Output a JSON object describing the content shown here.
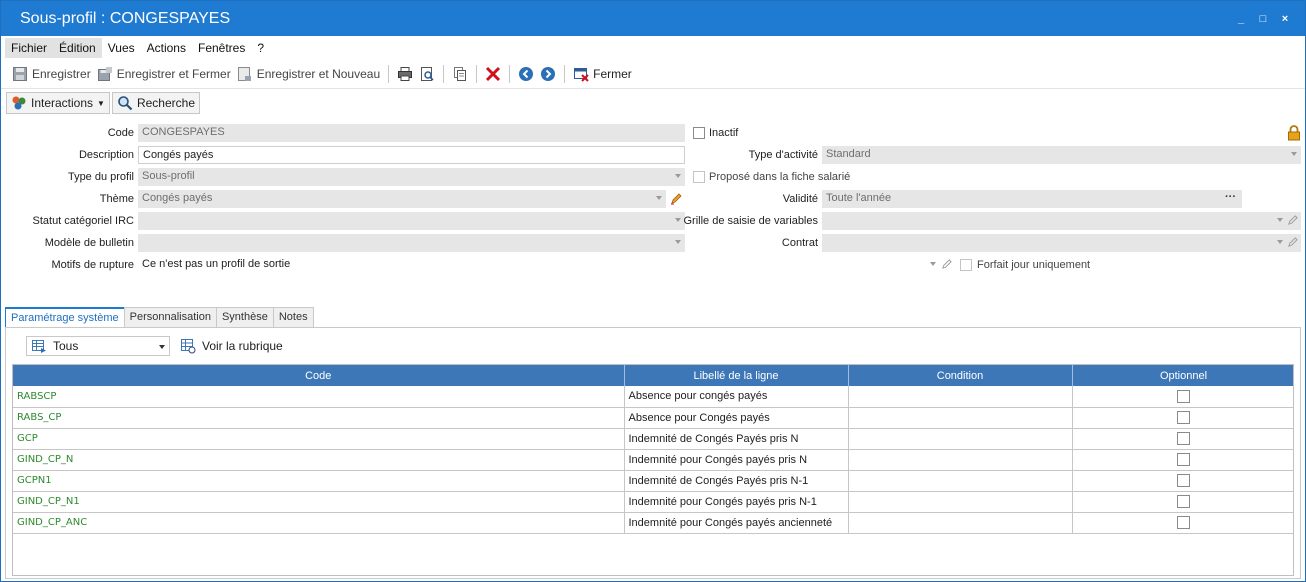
{
  "window": {
    "title": "Sous-profil : CONGESPAYES",
    "controls": {
      "minimize": "_",
      "maximize": "□",
      "close": "×"
    }
  },
  "menu": [
    "Fichier",
    "Édition",
    "Vues",
    "Actions",
    "Fenêtres",
    "?"
  ],
  "toolbar": {
    "save": "Enregistrer",
    "save_close": "Enregistrer et Fermer",
    "save_new": "Enregistrer et Nouveau",
    "close": "Fermer"
  },
  "toolbar2": {
    "interactions": "Interactions",
    "search": "Recherche"
  },
  "form": {
    "code_label": "Code",
    "code_value": "CONGESPAYES",
    "description_label": "Description",
    "description_value": "Congés payés",
    "type_profil_label": "Type du profil",
    "type_profil_value": "Sous-profil",
    "theme_label": "Thème",
    "theme_value": "Congés payés",
    "statut_label": "Statut catégoriel IRC",
    "statut_value": "",
    "modele_label": "Modèle de bulletin",
    "modele_value": "",
    "motifs_label": "Motifs de rupture",
    "motifs_value": "Ce n'est pas un profil de sortie",
    "inactif_label": "Inactif",
    "type_activite_label": "Type d'activité",
    "type_activite_value": "Standard",
    "propose_label": "Proposé dans la fiche salarié",
    "validite_label": "Validité",
    "validite_value": "Toute l'année",
    "validite_button": "···",
    "grille_label": "Grille de saisie de variables",
    "grille_value": "",
    "contrat_label": "Contrat",
    "contrat_value": "",
    "forfait_label": "Forfait jour uniquement"
  },
  "tabs": [
    "Paramétrage système",
    "Personnalisation",
    "Synthèse",
    "Notes"
  ],
  "panel": {
    "filter_value": "Tous",
    "voir_rubrique": "Voir la rubrique"
  },
  "grid": {
    "columns": [
      "Code",
      "Libellé de la ligne",
      "Condition",
      "Optionnel"
    ],
    "rows": [
      {
        "code": "RABSCP",
        "libelle": "Absence pour congés payés",
        "condition": "",
        "optionnel": false
      },
      {
        "code": "RABS_CP",
        "libelle": "Absence pour Congés payés",
        "condition": "",
        "optionnel": false
      },
      {
        "code": "GCP",
        "libelle": "Indemnité de Congés Payés pris N",
        "condition": "",
        "optionnel": false
      },
      {
        "code": "GIND_CP_N",
        "libelle": "Indemnité pour Congés payés pris N",
        "condition": "",
        "optionnel": false
      },
      {
        "code": "GCPN1",
        "libelle": "Indemnité de Congés Payés pris N-1",
        "condition": "",
        "optionnel": false
      },
      {
        "code": "GIND_CP_N1",
        "libelle": "Indemnité pour Congés payés pris N-1",
        "condition": "",
        "optionnel": false
      },
      {
        "code": "GIND_CP_ANC",
        "libelle": "Indemnité pour Congés payés ancienneté",
        "condition": "",
        "optionnel": false
      }
    ]
  },
  "colors": {
    "titlebar": "#1f7ad2",
    "grid_header": "#3d77b7",
    "code_text": "#2e8a2e"
  }
}
